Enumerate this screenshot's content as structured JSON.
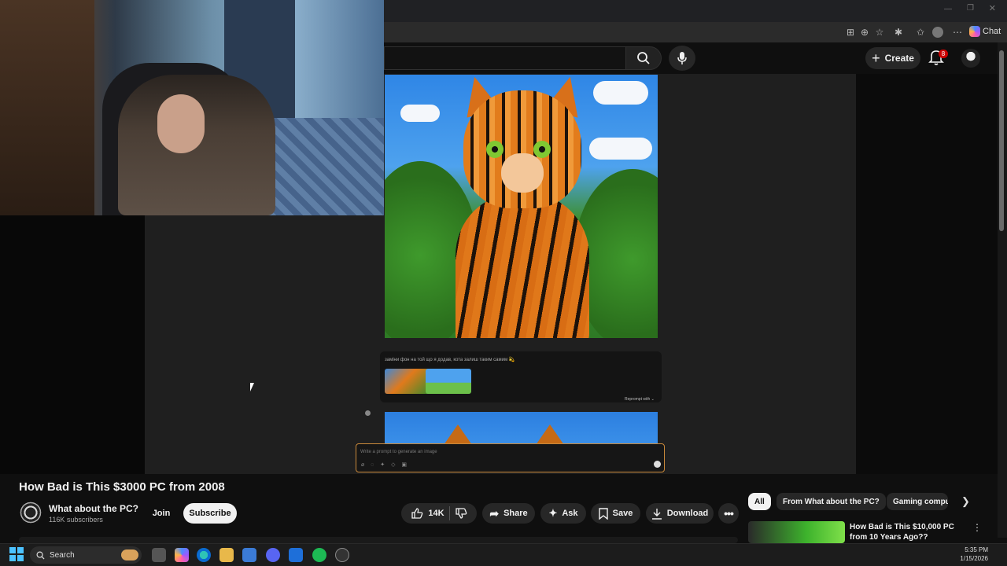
{
  "browser": {
    "chat_label": "Chat"
  },
  "youtube_header": {
    "create_label": "Create",
    "notification_count": "8"
  },
  "generator": {
    "prompt_message": "заміни фон на той що я додав, кота залиш таким самим 💫",
    "reprompt_label": "Reprompt with ⌄",
    "input_placeholder": "Write a prompt to generate an image"
  },
  "video": {
    "title": "How Bad is This $3000 PC from 2008",
    "channel_name": "What about the PC?",
    "subscribers": "116K subscribers",
    "join_label": "Join",
    "subscribe_label": "Subscribe",
    "likes": "14K",
    "share_label": "Share",
    "ask_label": "Ask",
    "save_label": "Save",
    "download_label": "Download"
  },
  "sidebar": {
    "chips": [
      "All",
      "From What about the PC?",
      "Gaming compu"
    ],
    "recommendation_title": "How Bad is This $10,000 PC from 10 Years Ago??"
  },
  "taskbar": {
    "search_label": "Search",
    "time": "5:35 PM",
    "date": "1/15/2026",
    "spotify_color": "#1db954"
  },
  "colors": {
    "accent_red": "#cc0000",
    "background": "#0f0f0f"
  }
}
